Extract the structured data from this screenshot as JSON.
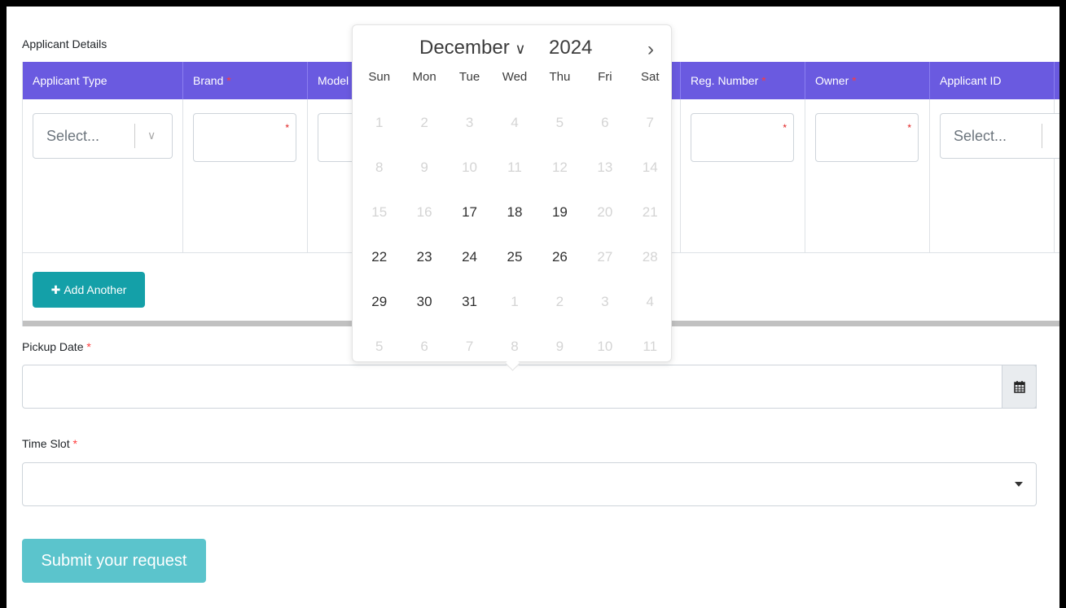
{
  "section_title": "Applicant Details",
  "table": {
    "headers": [
      {
        "label": "Applicant Type",
        "required": false
      },
      {
        "label": "Brand",
        "required": true
      },
      {
        "label": "Model",
        "required": false
      },
      {
        "label": "",
        "required": false
      },
      {
        "label": "",
        "required": false
      },
      {
        "label": "Reg. Number",
        "required": true
      },
      {
        "label": "Owner",
        "required": true
      },
      {
        "label": "Applicant ID",
        "required": false
      }
    ],
    "required_mark": "*",
    "select_placeholder": "Select...",
    "add_button": "Add Another"
  },
  "pickup": {
    "label": "Pickup Date",
    "required_mark": "*",
    "value": ""
  },
  "timeslot": {
    "label": "Time Slot",
    "required_mark": "*",
    "value": ""
  },
  "submit_label": "Submit your request",
  "datepicker": {
    "month": "December",
    "year": "2024",
    "weekdays": [
      "Sun",
      "Mon",
      "Tue",
      "Wed",
      "Thu",
      "Fri",
      "Sat"
    ],
    "weeks": [
      [
        {
          "d": "1",
          "en": false
        },
        {
          "d": "2",
          "en": false
        },
        {
          "d": "3",
          "en": false
        },
        {
          "d": "4",
          "en": false
        },
        {
          "d": "5",
          "en": false
        },
        {
          "d": "6",
          "en": false
        },
        {
          "d": "7",
          "en": false
        }
      ],
      [
        {
          "d": "8",
          "en": false
        },
        {
          "d": "9",
          "en": false
        },
        {
          "d": "10",
          "en": false
        },
        {
          "d": "11",
          "en": false
        },
        {
          "d": "12",
          "en": false
        },
        {
          "d": "13",
          "en": false
        },
        {
          "d": "14",
          "en": false
        }
      ],
      [
        {
          "d": "15",
          "en": false
        },
        {
          "d": "16",
          "en": false
        },
        {
          "d": "17",
          "en": true
        },
        {
          "d": "18",
          "en": true
        },
        {
          "d": "19",
          "en": true
        },
        {
          "d": "20",
          "en": false
        },
        {
          "d": "21",
          "en": false
        }
      ],
      [
        {
          "d": "22",
          "en": true
        },
        {
          "d": "23",
          "en": true
        },
        {
          "d": "24",
          "en": true
        },
        {
          "d": "25",
          "en": true
        },
        {
          "d": "26",
          "en": true
        },
        {
          "d": "27",
          "en": false
        },
        {
          "d": "28",
          "en": false
        }
      ],
      [
        {
          "d": "29",
          "en": true
        },
        {
          "d": "30",
          "en": true
        },
        {
          "d": "31",
          "en": true
        },
        {
          "d": "1",
          "en": false
        },
        {
          "d": "2",
          "en": false
        },
        {
          "d": "3",
          "en": false
        },
        {
          "d": "4",
          "en": false
        }
      ],
      [
        {
          "d": "5",
          "en": false
        },
        {
          "d": "6",
          "en": false
        },
        {
          "d": "7",
          "en": false
        },
        {
          "d": "8",
          "en": false
        },
        {
          "d": "9",
          "en": false
        },
        {
          "d": "10",
          "en": false
        },
        {
          "d": "11",
          "en": false
        }
      ]
    ]
  },
  "colors": {
    "header": "#6a5ae0",
    "add_button": "#14a0a8",
    "submit": "#5bc4cc",
    "required": "#e02020"
  }
}
